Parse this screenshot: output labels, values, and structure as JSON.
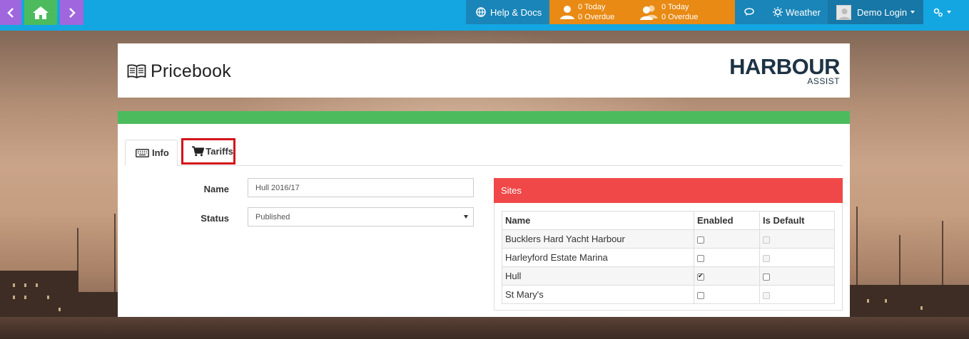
{
  "topbar": {
    "help_label": "Help & Docs",
    "counters": [
      {
        "today": "0 Today",
        "overdue": "0 Overdue"
      },
      {
        "today": "0 Today",
        "overdue": "0 Overdue"
      }
    ],
    "weather_label": "Weather",
    "user_label": "Demo Login"
  },
  "header": {
    "title": "Pricebook",
    "logo_main": "HARBOUR",
    "logo_sub": "ASSIST"
  },
  "tabs": [
    {
      "label": "Info",
      "icon": "keyboard-icon",
      "active": true
    },
    {
      "label": "Tariffs",
      "icon": "cart-icon",
      "highlighted": true
    }
  ],
  "form": {
    "name_label": "Name",
    "name_value": "Hull 2016/17",
    "status_label": "Status",
    "status_value": "Published"
  },
  "sites": {
    "title": "Sites",
    "columns": [
      "Name",
      "Enabled",
      "Is Default"
    ],
    "rows": [
      {
        "name": "Bucklers Hard Yacht Harbour",
        "enabled": false,
        "is_default": false,
        "default_disabled": true
      },
      {
        "name": "Harleyford Estate Marina",
        "enabled": false,
        "is_default": false,
        "default_disabled": true
      },
      {
        "name": "Hull",
        "enabled": true,
        "is_default": false,
        "default_disabled": false
      },
      {
        "name": "St Mary's",
        "enabled": false,
        "is_default": false,
        "default_disabled": true
      }
    ]
  },
  "colors": {
    "topbar": "#14a6e0",
    "nav_purple": "#a066de",
    "nav_green": "#4cbb5e",
    "orange": "#e88a14",
    "sites_header": "#f04848",
    "highlight_red": "#d3121a"
  }
}
